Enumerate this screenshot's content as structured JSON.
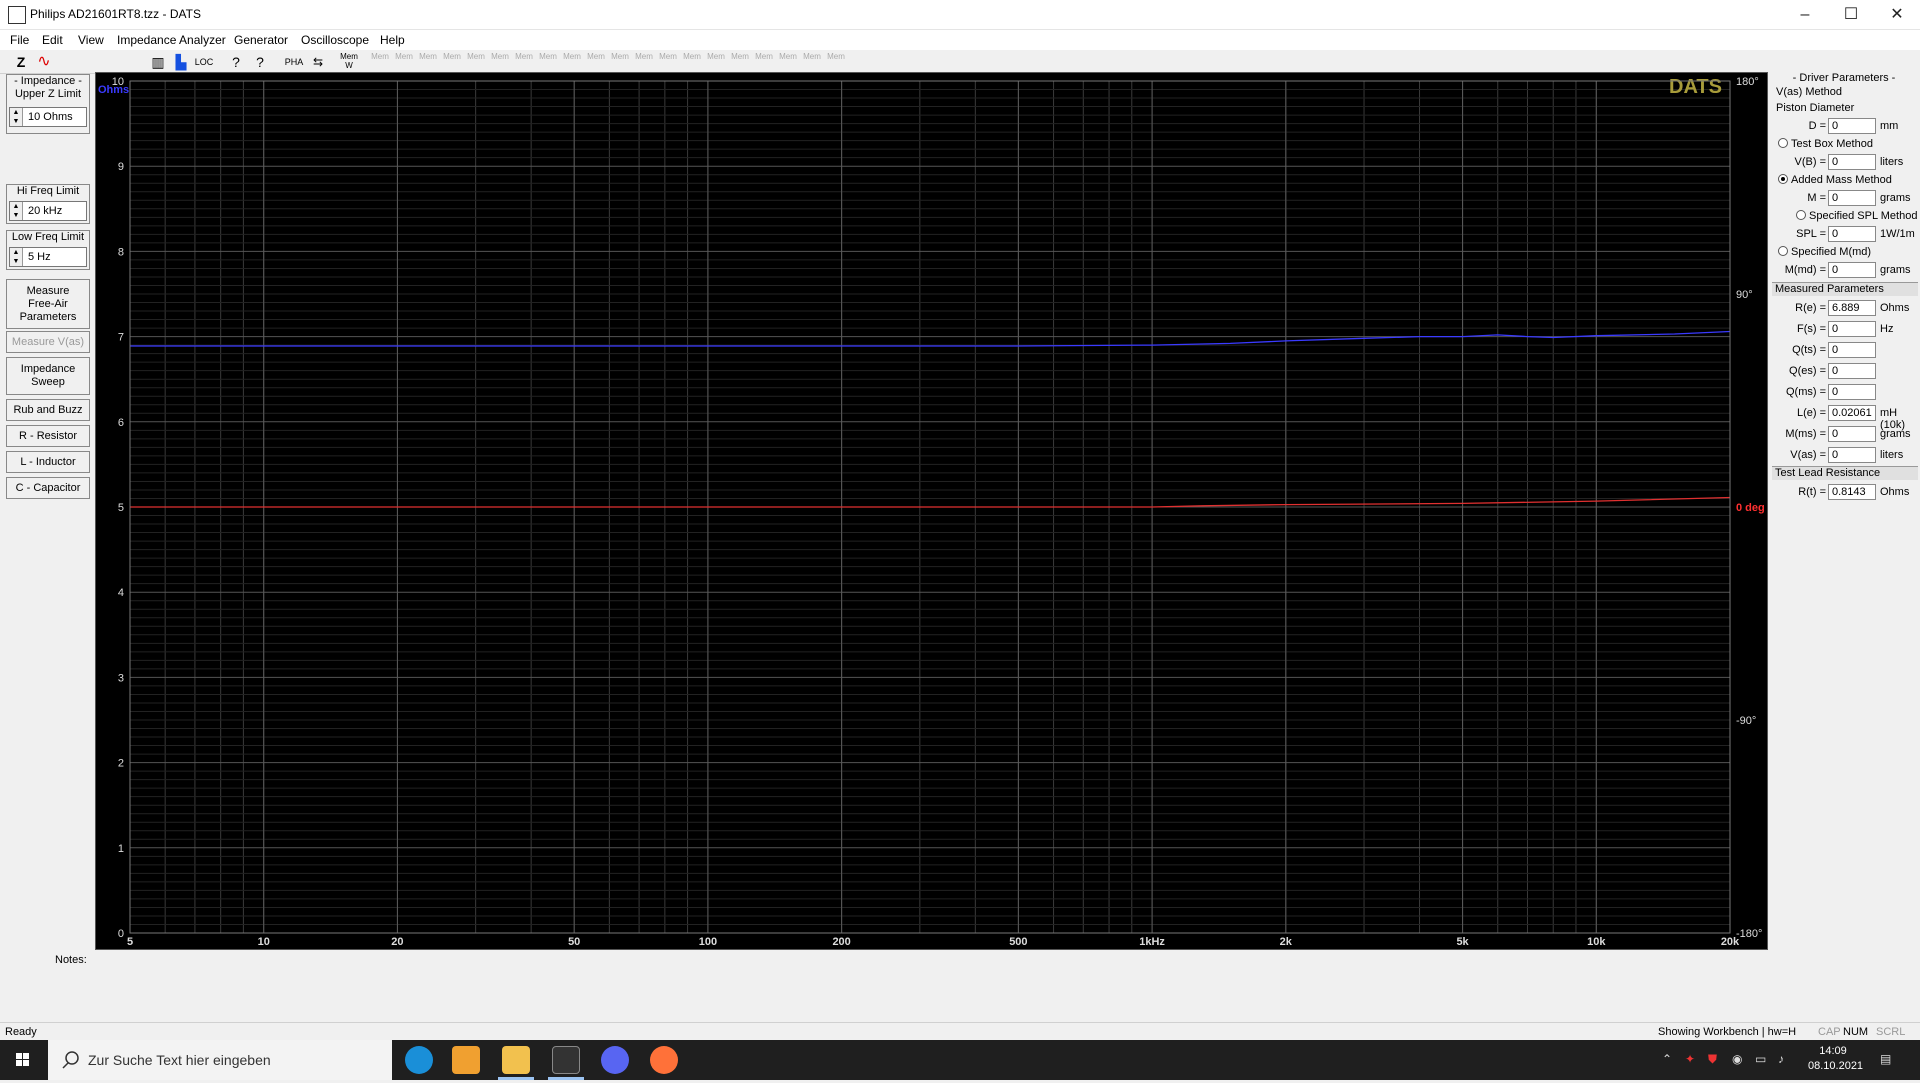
{
  "window": {
    "title": "Philips AD21601RT8.tzz - DATS",
    "min": "–",
    "max": "☐",
    "close": "✕"
  },
  "menu": [
    "File",
    "Edit",
    "View",
    "Impedance Analyzer",
    "Generator",
    "Oscilloscope",
    "Help"
  ],
  "toolbar": {
    "z": "Z",
    "pha": "PHA",
    "loc": "LOC",
    "mem_label": "Mem",
    "w": "W"
  },
  "left": {
    "upper_z_title": "- Impedance -\nUpper Z Limit",
    "upper_z_value": "10 Ohms",
    "hi_freq_title": "Hi Freq Limit",
    "hi_freq_value": "20 kHz",
    "low_freq_title": "Low Freq Limit",
    "low_freq_value": "5 Hz",
    "buttons": [
      "Measure\nFree-Air\nParameters",
      "Measure V(as)",
      "Impedance\nSweep",
      "Rub and Buzz",
      "R - Resistor",
      "L - Inductor",
      "C - Capacitor"
    ]
  },
  "chart_data": {
    "type": "line",
    "title": "",
    "watermark": "DATS",
    "xlabel": "",
    "ylabel": "Ohms",
    "x_scale": "log",
    "xlim": [
      5,
      20000
    ],
    "ylim": [
      0,
      10
    ],
    "y2lim": [
      -180,
      180
    ],
    "x_ticks": [
      {
        "v": 5,
        "t": "5"
      },
      {
        "v": 10,
        "t": "10"
      },
      {
        "v": 20,
        "t": "20"
      },
      {
        "v": 50,
        "t": "50"
      },
      {
        "v": 100,
        "t": "100"
      },
      {
        "v": 200,
        "t": "200"
      },
      {
        "v": 500,
        "t": "500"
      },
      {
        "v": 1000,
        "t": "1kHz"
      },
      {
        "v": 2000,
        "t": "2k"
      },
      {
        "v": 5000,
        "t": "5k"
      },
      {
        "v": 10000,
        "t": "10k"
      },
      {
        "v": 20000,
        "t": "20k"
      }
    ],
    "y_ticks": [
      "0",
      "1",
      "2",
      "3",
      "4",
      "5",
      "6",
      "7",
      "8",
      "9",
      "10"
    ],
    "y2_ticks": [
      {
        "v": 180,
        "t": "180°"
      },
      {
        "v": 90,
        "t": "90°"
      },
      {
        "v": 0,
        "t": "0 deg"
      },
      {
        "v": -90,
        "t": "-90°"
      },
      {
        "v": -180,
        "t": "-180°"
      }
    ],
    "grid": true,
    "series": [
      {
        "color": "#3a3aff",
        "axis": "y",
        "x": [
          5,
          10,
          50,
          100,
          500,
          1000,
          1500,
          2000,
          3000,
          4000,
          5000,
          6000,
          7000,
          8000,
          10000,
          15000,
          20000
        ],
        "y": [
          6.89,
          6.89,
          6.89,
          6.89,
          6.89,
          6.9,
          6.92,
          6.95,
          6.98,
          7.0,
          7.0,
          7.02,
          7.0,
          6.99,
          7.01,
          7.03,
          7.06
        ]
      },
      {
        "color": "#e03030",
        "axis": "y2",
        "x": [
          5,
          100,
          1000,
          1300,
          2000,
          5000,
          10000,
          20000
        ],
        "y": [
          0,
          0,
          0,
          0.5,
          1,
          1.5,
          2.5,
          4
        ]
      }
    ]
  },
  "right": {
    "title": "- Driver Parameters -",
    "vas_method": "V(as) Method",
    "piston": "Piston Diameter",
    "d_label": "D =",
    "d_value": "0",
    "d_unit": "mm",
    "test_box": "Test Box Method",
    "vb_label": "V(B) =",
    "vb_value": "0",
    "vb_unit": "liters",
    "added_mass": "Added Mass Method",
    "m_label": "M =",
    "m_value": "0",
    "m_unit": "grams",
    "spl_method": "Specified SPL Method",
    "spl_label": "SPL =",
    "spl_value": "0",
    "spl_unit": "1W/1m",
    "mmd_method": "Specified M(md)",
    "mmd_label": "M(md) =",
    "mmd_value": "0",
    "mmd_unit": "grams",
    "measured": "Measured Parameters",
    "params": [
      {
        "l": "R(e) =",
        "v": "6.889",
        "u": "Ohms"
      },
      {
        "l": "F(s) =",
        "v": "0",
        "u": "Hz"
      },
      {
        "l": "Q(ts) =",
        "v": "0",
        "u": ""
      },
      {
        "l": "Q(es) =",
        "v": "0",
        "u": ""
      },
      {
        "l": "Q(ms) =",
        "v": "0",
        "u": ""
      },
      {
        "l": "L(e) =",
        "v": "0.02061",
        "u": "mH (10k)"
      },
      {
        "l": "M(ms) =",
        "v": "0",
        "u": "grams"
      },
      {
        "l": "V(as) =",
        "v": "0",
        "u": "liters"
      }
    ],
    "lead": "Test Lead Resistance",
    "rt_label": "R(t) =",
    "rt_value": "0.8143",
    "rt_unit": "Ohms"
  },
  "notes_label": "Notes:",
  "status": {
    "left": "Ready",
    "right": "Showing Workbench | hw=H",
    "cap": "CAP",
    "num": "NUM",
    "scrl": "SCRL"
  },
  "taskbar": {
    "search": "Zur Suche Text hier eingeben",
    "time": "14:09",
    "date": "08.10.2021"
  }
}
